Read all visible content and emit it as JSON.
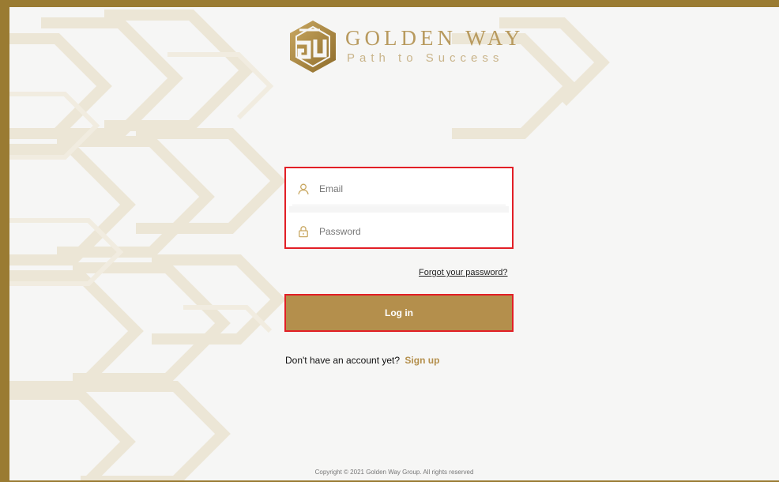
{
  "brand": {
    "name": "GOLDEN WAY",
    "tagline": "Path to Success",
    "logo_icon": "gw-monogram-icon"
  },
  "colors": {
    "frame": "#9a7b32",
    "accent": "#b48f4c",
    "highlight": "#e21f26"
  },
  "login": {
    "email_placeholder": "Email",
    "email_value": "",
    "email_icon": "user-icon",
    "password_placeholder": "Password",
    "password_value": "",
    "password_icon": "lock-icon",
    "forgot_label": "Forgot your password?",
    "submit_label": "Log in"
  },
  "signup": {
    "prompt": "Don't have an account yet?",
    "link_label": "Sign up"
  },
  "footer": {
    "copyright": "Copyright © 2021 Golden Way Group. All rights reserved"
  }
}
